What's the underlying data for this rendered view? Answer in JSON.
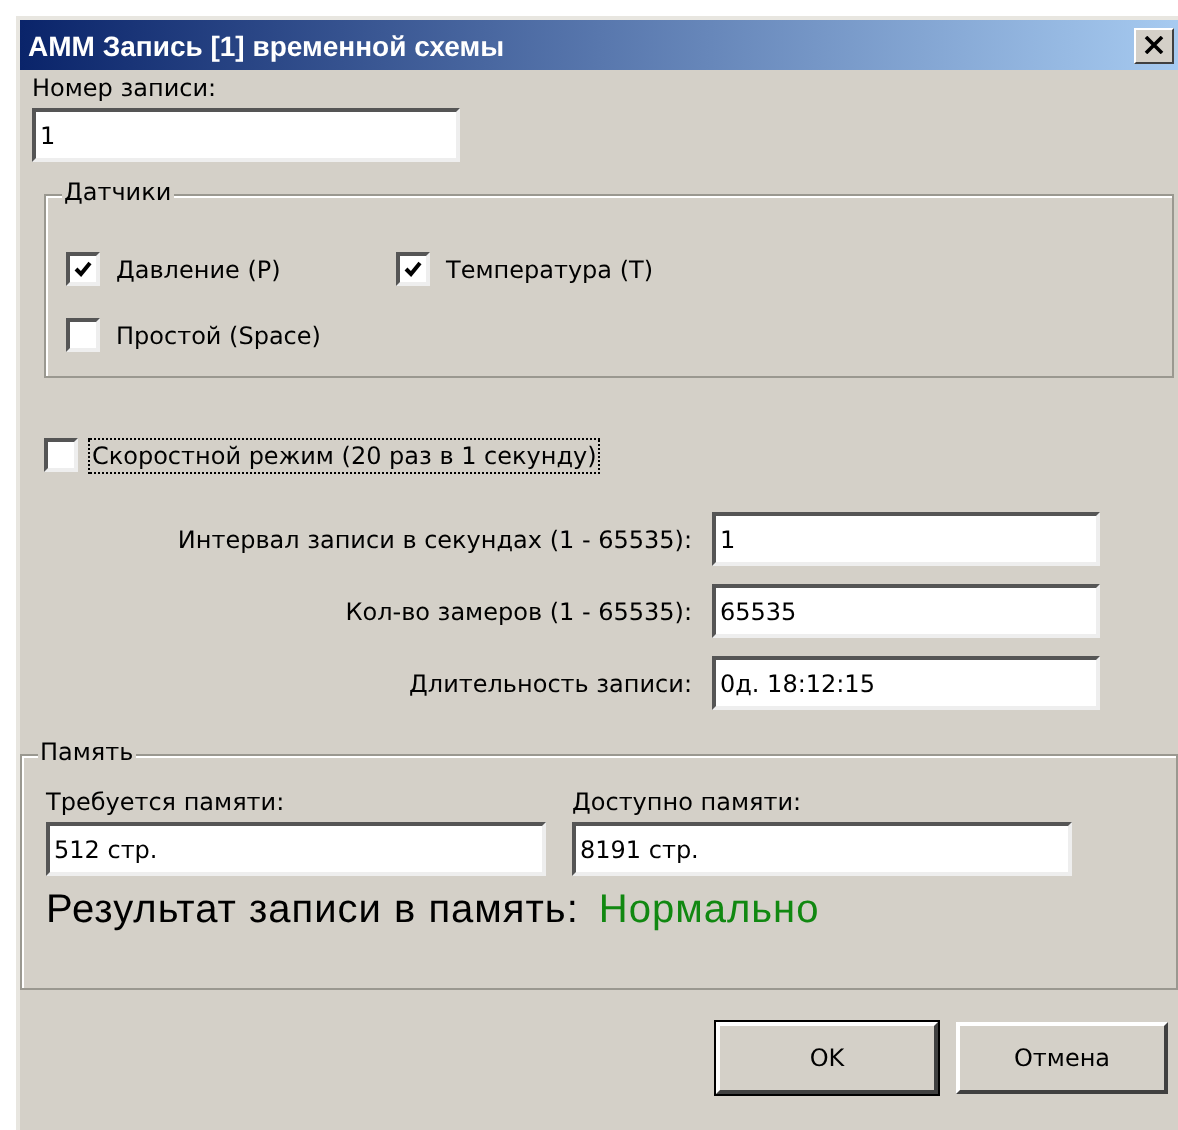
{
  "window": {
    "title": "АММ Запись [1] временной схемы"
  },
  "record_number": {
    "label": "Номер записи:",
    "value": "1"
  },
  "sensors": {
    "title": "Датчики",
    "items": [
      {
        "label": "Давление (P)",
        "checked": true
      },
      {
        "label": "Температура (T)",
        "checked": true
      },
      {
        "label": "Простой (Space)",
        "checked": false
      }
    ]
  },
  "speed_mode": {
    "label": "Скоростной режим (20 раз в 1 секунду)",
    "checked": false,
    "focused": true
  },
  "fields": [
    {
      "label": "Интервал записи в секундах (1 - 65535):",
      "value": "1"
    },
    {
      "label": "Кол-во замеров (1 - 65535):",
      "value": "65535"
    },
    {
      "label": "Длительность записи:",
      "value": "0д. 18:12:15"
    }
  ],
  "memory": {
    "title": "Память",
    "required": {
      "label": "Требуется памяти:",
      "value": "512 стр."
    },
    "available": {
      "label": "Доступно памяти:",
      "value": "8191 стр."
    },
    "result_label": "Результат записи в память:",
    "result_value": "Нормально",
    "result_ok": true
  },
  "buttons": [
    {
      "label": "OK",
      "default": true
    },
    {
      "label": "Отмена",
      "default": false
    }
  ]
}
